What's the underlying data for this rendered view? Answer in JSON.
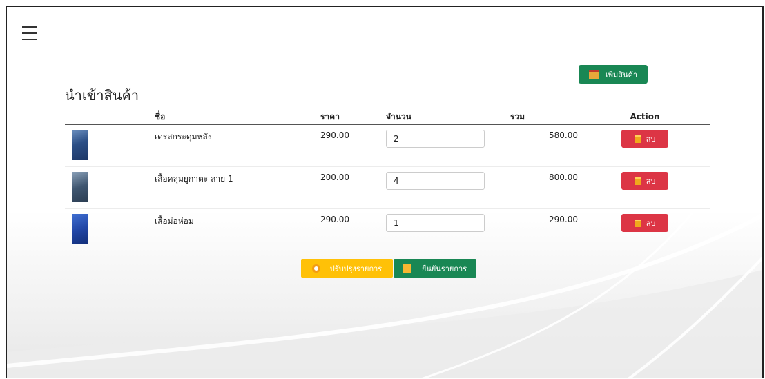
{
  "header": {
    "menu_icon": "hamburger-icon"
  },
  "toolbar": {
    "add_label": "เพิ่มสินค้า",
    "add_icon": "store-icon"
  },
  "page": {
    "title": "นำเข้าสินค้า"
  },
  "table": {
    "columns": [
      "ชื่อ",
      "ราคา",
      "จำนวน",
      "รวม",
      "Action"
    ],
    "rows": [
      {
        "name": "เดรสกระดุมหลัง",
        "price": "290.00",
        "qty": "2",
        "total": "580.00",
        "delete_label": "ลบ"
      },
      {
        "name": "เสื้อคลุมยูกาตะ ลาย 1",
        "price": "200.00",
        "qty": "4",
        "total": "800.00",
        "delete_label": "ลบ"
      },
      {
        "name": "เสื้อม่อห่อม",
        "price": "290.00",
        "qty": "1",
        "total": "290.00",
        "delete_label": "ลบ"
      }
    ]
  },
  "actions": {
    "update_label": "ปรับปรุงรายการ",
    "confirm_label": "ยืนยันรายการ"
  },
  "colors": {
    "primary_green": "#198754",
    "danger_red": "#dc3545",
    "warning_yellow": "#ffc107"
  }
}
